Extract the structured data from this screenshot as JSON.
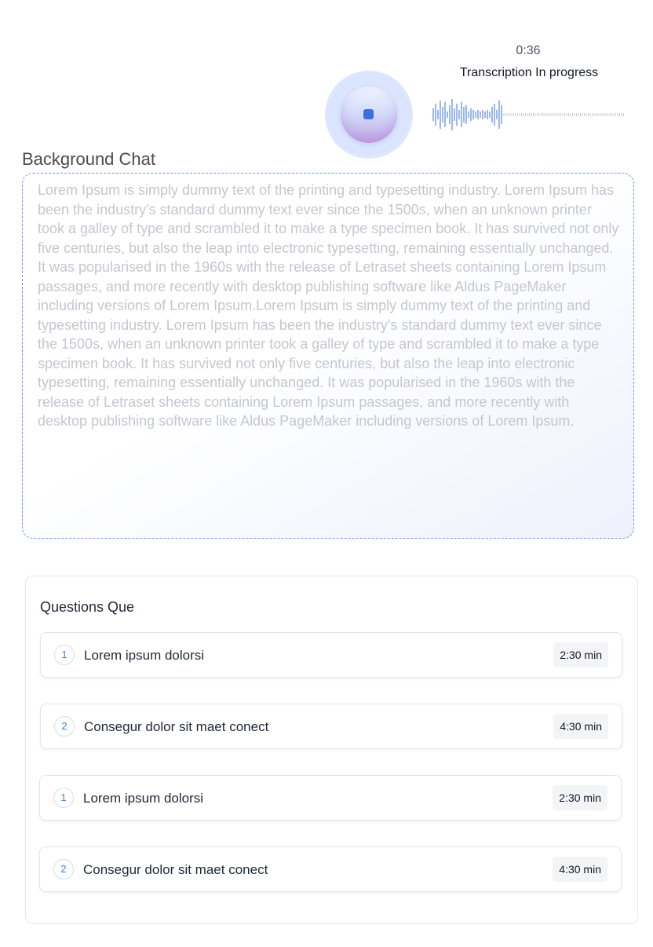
{
  "recorder": {
    "timer": "0:36",
    "status": "Transcription In progress",
    "accent": "#3b6fe0",
    "stop_icon": "stop-icon"
  },
  "background_chat": {
    "title": "Background Chat",
    "text": "Lorem Ipsum is simply dummy text of the printing and typesetting industry. Lorem Ipsum has been the industry's standard dummy text ever since the 1500s, when an unknown printer took a galley of type and scrambled it to make a type specimen book. It has survived not only five centuries, but also the leap into electronic typesetting, remaining essentially unchanged. It was popularised in the 1960s with the release of Letraset sheets containing Lorem Ipsum passages, and more recently with desktop publishing software like Aldus PageMaker including versions of Lorem Ipsum.Lorem Ipsum is simply dummy text of the printing and typesetting industry. Lorem Ipsum has been the industry's standard dummy text ever since the 1500s, when an unknown printer took a galley of type and scrambled it to make a type specimen book. It has survived not only five centuries, but also the leap into electronic typesetting, remaining essentially unchanged. It was popularised in the 1960s with the release of Letraset sheets containing Lorem Ipsum passages, and more recently with desktop publishing software like Aldus PageMaker including versions of Lorem Ipsum."
  },
  "questions": {
    "title": "Questions Que",
    "items": [
      {
        "number": "1",
        "text": "Lorem ipsum dolorsi",
        "duration": "2:30 min"
      },
      {
        "number": "2",
        "text": "Consegur dolor sit maet conect",
        "duration": "4:30 min"
      },
      {
        "number": "1",
        "text": "Lorem ipsum dolorsi",
        "duration": "2:30 min"
      },
      {
        "number": "2",
        "text": "Consegur dolor sit maet conect",
        "duration": "4:30 min"
      }
    ]
  }
}
